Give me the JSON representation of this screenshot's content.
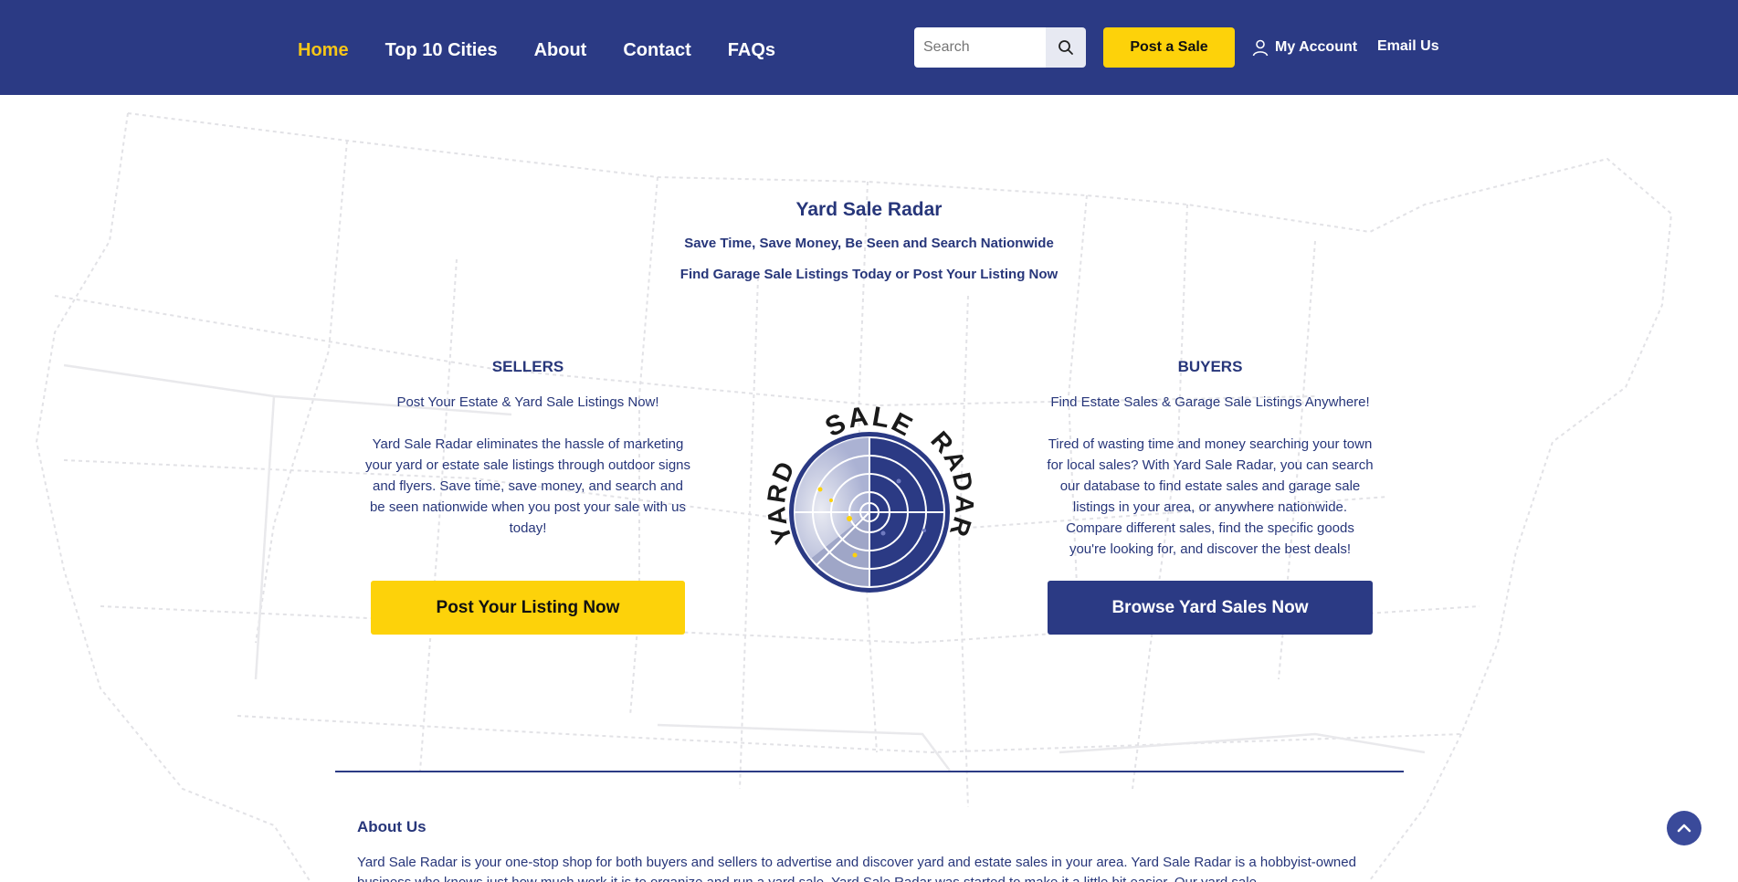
{
  "header": {
    "nav": [
      "Home",
      "Top 10 Cities",
      "About",
      "Contact",
      "FAQs"
    ],
    "search_placeholder": "Search",
    "post_button": "Post a Sale",
    "account": "My Account",
    "email": "Email Us"
  },
  "hero": {
    "title": "Yard Sale Radar",
    "subtitle1": "Save Time, Save Money, Be Seen and Search Nationwide",
    "subtitle2": "Find Garage Sale Listings Today or Post Your Listing Now"
  },
  "sellers": {
    "heading": "SELLERS",
    "tagline": "Post Your Estate & Yard Sale Listings Now!",
    "body": "Yard Sale Radar eliminates the hassle of marketing your yard or estate sale listings through outdoor signs and flyers. Save time, save money, and search and be seen nationwide when you post your sale with us today!",
    "button": "Post Your Listing Now"
  },
  "logo": {
    "word_top": "SALE",
    "word_left": "YARD",
    "word_right": "RADAR"
  },
  "buyers": {
    "heading": "BUYERS",
    "tagline": "Find Estate Sales & Garage Sale Listings Anywhere!",
    "body": "Tired of wasting time and money searching your town for local sales? With Yard Sale Radar, you can search our database to find estate sales and garage sale listings in your area, or anywhere nationwide. Compare different sales, find the specific goods you're looking for, and discover the best deals!",
    "button": "Browse Yard Sales Now"
  },
  "about": {
    "title": "About Us",
    "body": "Yard Sale Radar is your one-stop shop for both buyers and sellers to advertise and discover yard and estate sales in your area. Yard Sale Radar is a hobbyist-owned business who knows just how much work it is to organize and run a yard sale. Yard Sale Radar was started to make it a little bit easier. Our yard sale"
  },
  "colors": {
    "header_bg": "#2b3a84",
    "accent_yellow": "#fdd20a",
    "text_blue": "#27367a"
  }
}
